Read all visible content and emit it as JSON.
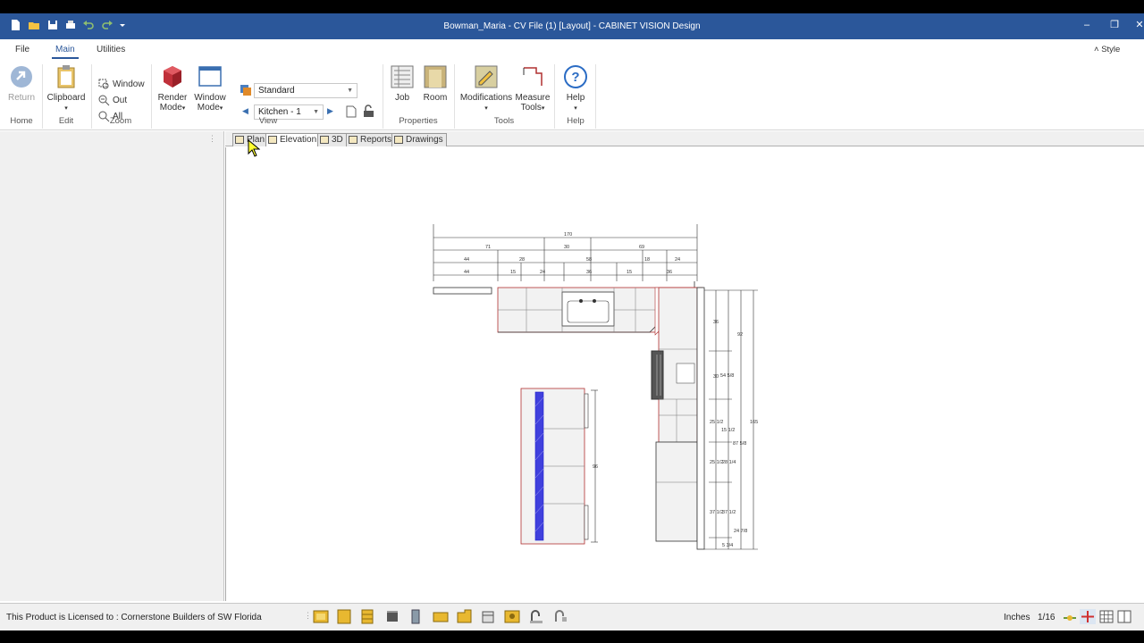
{
  "window": {
    "title": "Bowman_Maria - CV File (1) [Layout] - CABINET VISION Design",
    "controls": [
      "minimize",
      "restore",
      "close"
    ]
  },
  "menu": {
    "tabs": [
      "File",
      "Main",
      "Utilities"
    ],
    "active": "Main",
    "style_label": "Style"
  },
  "ribbon": {
    "home": {
      "return_label": "Return",
      "group": "Home"
    },
    "edit": {
      "clipboard_label": "Clipboard",
      "group": "Edit"
    },
    "zoom": {
      "window_label": "Window",
      "out_label": "Out",
      "all_label": "All",
      "group": "Zoom"
    },
    "view": {
      "render_label_1": "Render",
      "render_label_2": "Mode",
      "window_mode_label_1": "Window",
      "window_mode_label_2": "Mode",
      "render_style_value": "Standard",
      "room_value": "Kitchen - 1",
      "group": "View"
    },
    "properties": {
      "job_label": "Job",
      "room_label": "Room",
      "group": "Properties"
    },
    "tools": {
      "modifications_label": "Modifications",
      "measure_label_1": "Measure",
      "measure_label_2": "Tools",
      "group": "Tools"
    },
    "help": {
      "help_label": "Help",
      "group": "Help"
    }
  },
  "view_tabs": [
    {
      "label": "Plan",
      "icon": "plan-icon"
    },
    {
      "label": "Elevation",
      "icon": "elevation-icon"
    },
    {
      "label": "3D",
      "icon": "cube-icon"
    },
    {
      "label": "Reports",
      "icon": "reports-icon"
    },
    {
      "label": "Drawings",
      "icon": "drawings-icon"
    }
  ],
  "active_view_tab": "Elevation",
  "drawing": {
    "top_dims": [
      "170",
      "71",
      "30",
      "69",
      "44",
      "28",
      "58",
      "18",
      "24",
      "44",
      "15",
      "24",
      "36",
      "15",
      "36"
    ],
    "right_dims": [
      "36",
      "92",
      "30",
      "54 5/8",
      "165",
      "25 1/2",
      "15 1/2",
      "87 5/8",
      "25 1/2",
      "28 1/4",
      "37 1/2",
      "37 1/2",
      "24 7/8",
      "5 3/4"
    ],
    "island_dims": [
      "96"
    ]
  },
  "status": {
    "license": "This Product is Licensed to : Cornerstone Builders of SW Florida",
    "units": "Inches",
    "scale": "1/16"
  },
  "colors": {
    "title_bar": "#2b579a",
    "accent": "#2b579a",
    "island_hatch": "#2222cc",
    "cabinet_outline": "#b03030"
  }
}
